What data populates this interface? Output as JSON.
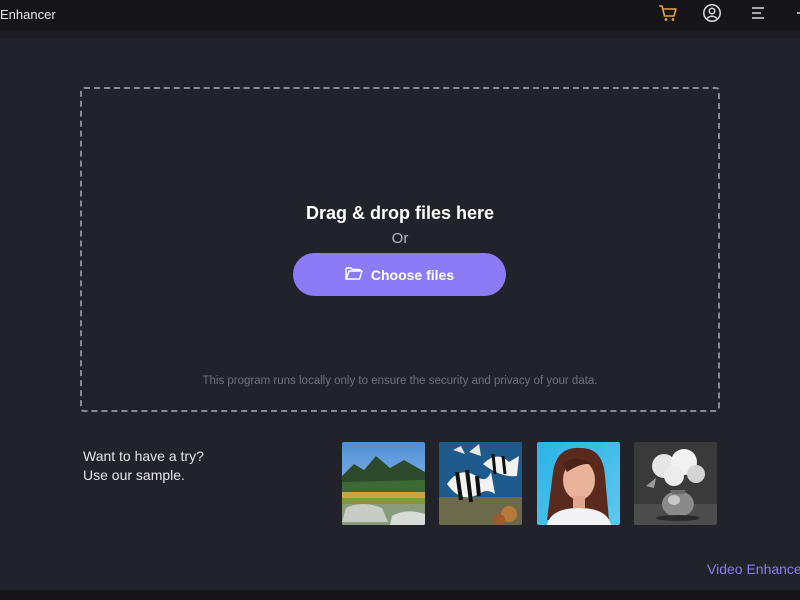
{
  "app": {
    "title": "Enhancer",
    "title_prefix_glyph": "↗"
  },
  "titlebar": {
    "icons": [
      "cart-icon",
      "account-icon",
      "menu-icon",
      "minimize-icon"
    ],
    "cart_color": "#e8a23a"
  },
  "dropzone": {
    "title": "Drag & drop files here",
    "or_text": "Or",
    "button_label": "Choose files",
    "privacy_note": "This program runs locally only to ensure the security and privacy of your data."
  },
  "samples": {
    "line1": "Want to have a try?",
    "line2": "Use our sample.",
    "items": [
      "landscape-sample",
      "fish-sample",
      "portrait-sample",
      "flower-sample"
    ]
  },
  "footer": {
    "video_link": "Video Enhancer"
  },
  "colors": {
    "accent": "#8b7cf6",
    "background": "#22222b",
    "titlebar": "#15151a"
  }
}
